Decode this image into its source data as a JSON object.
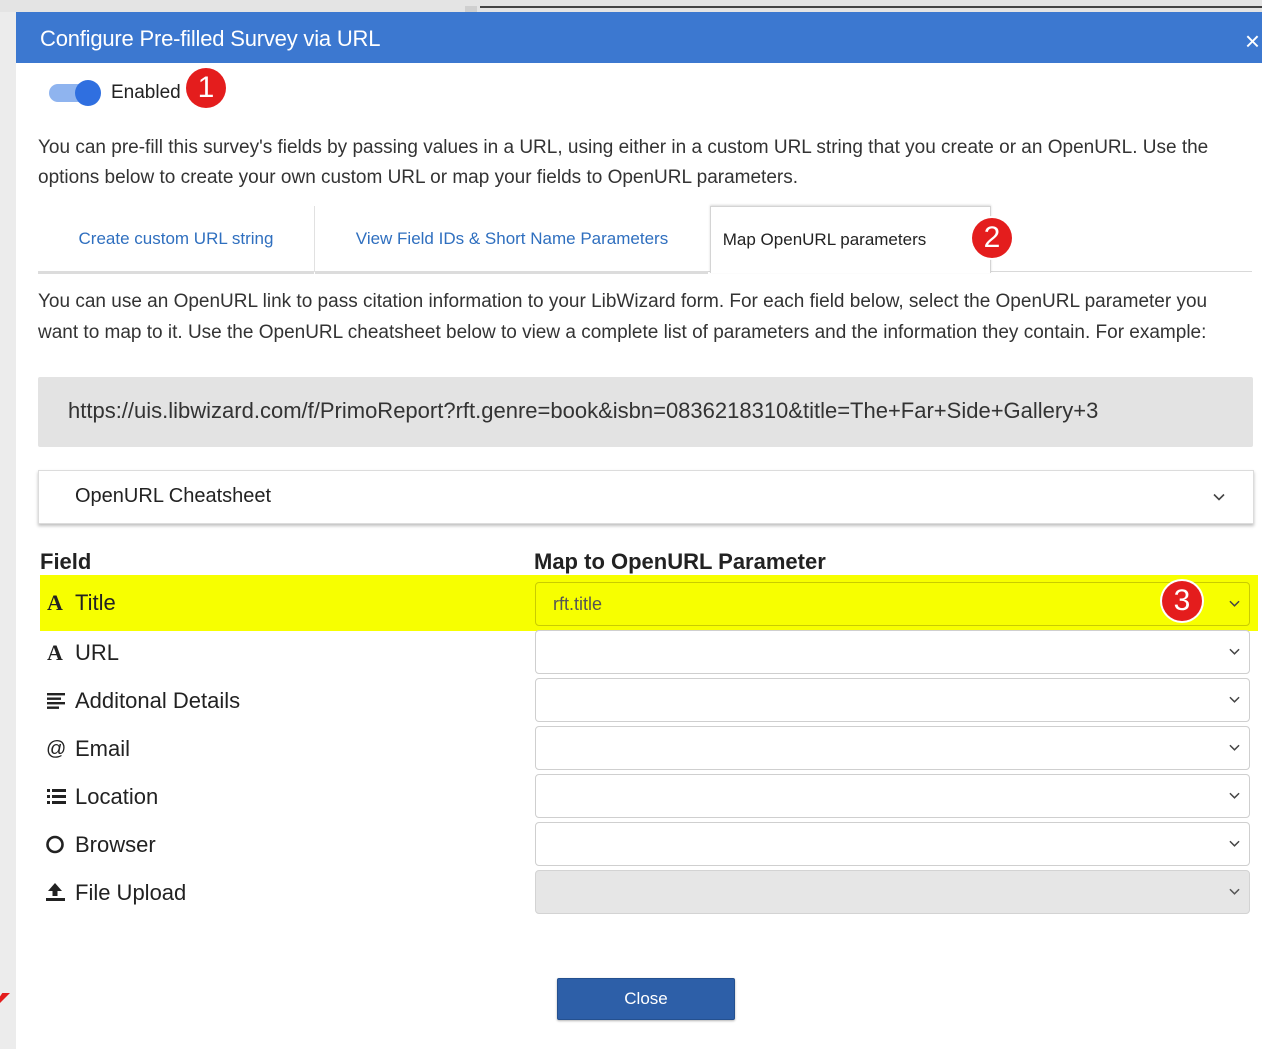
{
  "dialog": {
    "title": "Configure Pre-filled Survey via URL",
    "close_glyph": "×"
  },
  "toggle": {
    "label": "Enabled",
    "state": "on"
  },
  "annotations": [
    "1",
    "2",
    "3"
  ],
  "intro_text": "You can pre-fill this survey's fields by passing values in a URL, using either in a custom URL string that you create or an OpenURL. Use the options below to create your own custom URL or map your fields to OpenURL parameters.",
  "tabs": [
    {
      "label": "Create custom URL string",
      "active": false
    },
    {
      "label": "View Field IDs & Short Name Parameters",
      "active": false
    },
    {
      "label": "Map OpenURL parameters",
      "active": true
    }
  ],
  "openurl_text": "You can use an OpenURL link to pass citation information to your LibWizard form. For each field below, select the OpenURL parameter you want to map to it. Use the OpenURL cheatsheet below to view a complete list of parameters and the information they contain. For example:",
  "example_url": "https://uis.libwizard.com/f/PrimoReport?rft.genre=book&isbn=0836218310&title=The+Far+Side+Gallery+3",
  "cheatsheet": {
    "label": "OpenURL Cheatsheet"
  },
  "table": {
    "headers": {
      "field": "Field",
      "map": "Map to OpenURL Parameter"
    },
    "rows": [
      {
        "name": "Title",
        "icon": "text-icon",
        "value": "rft.title"
      },
      {
        "name": "URL",
        "icon": "text-icon",
        "value": ""
      },
      {
        "name": "Additonal Details",
        "icon": "paragraph-icon",
        "value": ""
      },
      {
        "name": "Email",
        "icon": "at-icon",
        "value": ""
      },
      {
        "name": "Location",
        "icon": "list-icon",
        "value": ""
      },
      {
        "name": "Browser",
        "icon": "radio-icon",
        "value": ""
      },
      {
        "name": "File Upload",
        "icon": "upload-icon",
        "value": ""
      }
    ]
  },
  "close_button": "Close",
  "colors": {
    "header": "#3c78d0",
    "highlight": "#f7ff00",
    "badge": "#e41d1d",
    "link": "#2f6fbf",
    "button": "#2d5fa8"
  }
}
